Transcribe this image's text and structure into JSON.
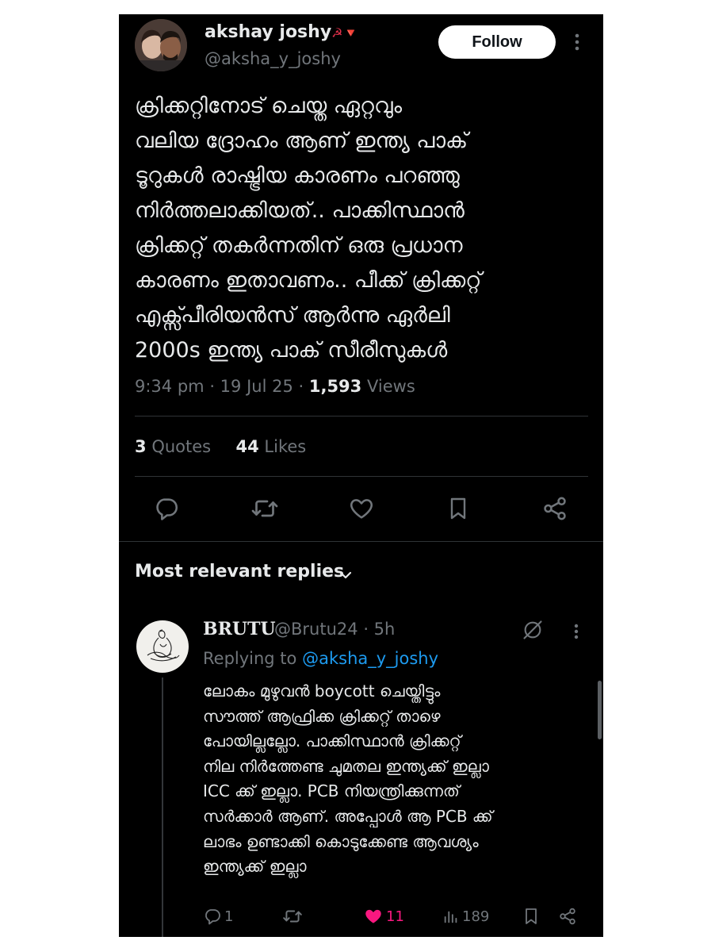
{
  "author": {
    "name": "akshay joshy",
    "name_emoji": "☭🔻",
    "handle": "@aksha_y_joshy",
    "follow_label": "Follow"
  },
  "tweet": {
    "lines": [
      "ക്രിക്കറ്റിനോട് ചെയ്ത ഏറ്റവും",
      "വലിയ ദ്രോഹം ആണ് ഇന്ത്യ പാക്",
      "ടൂറുകൾ രാഷ്ട്രിയ കാരണം പറഞ്ഞു",
      "നിർത്തലാക്കിയത്.. പാക്കിസ്ഥാൻ",
      "ക്രിക്കറ്റ് തകർന്നതിന് ഒരു പ്രധാന",
      "കാരണം ഇതാവണം.. പീക്ക് ക്രിക്കറ്റ്",
      "എക്സ്പീരിയൻസ് ആർന്നു ഏർലി",
      "2000s ഇന്ത്യ പാക് സീരീസുകൾ"
    ],
    "time": "9:34 pm",
    "date": "19 Jul 25",
    "views_count": "1,593",
    "views_label": "Views",
    "quotes_count": "3",
    "quotes_label": "Quotes",
    "likes_count": "44",
    "likes_label": "Likes"
  },
  "replies_header": "Most relevant replies",
  "reply": {
    "name": "BRUTU",
    "handle": "@Brutu24",
    "age": "5h",
    "replying_prefix": "Replying to",
    "replying_handle": "@aksha_y_joshy",
    "lines": [
      "ലോകം മുഴുവൻ boycott ചെയ്തിട്ടും",
      "സൗത്ത് ആഫ്രിക്ക ക്രിക്കറ്റ് താഴെ",
      "പോയില്ലല്ലോ. പാക്കിസ്ഥാൻ ക്രിക്കറ്റ്",
      "നില നിർത്തേണ്ട ചുമതല ഇന്ത്യക്ക് ഇല്ലാ",
      "ICC ക്ക് ഇല്ലാ. PCB നിയന്ത്രിക്കുന്നത്",
      "സർക്കാർ ആണ്. അപ്പോൾ ആ PCB ക്ക്",
      "ലാഭം ഉണ്ടാക്കി കൊടുക്കേണ്ട ആവശ്യം",
      "ഇന്ത്യക്ക് ഇല്ലാ"
    ],
    "reply_count": "1",
    "like_count": "11",
    "view_count": "189"
  },
  "colors": {
    "background": "#000000",
    "text": "#e7e9ea",
    "muted": "#71767b",
    "link": "#1d9bf0",
    "like_active": "#f91880"
  },
  "icons": [
    "more-vertical-icon",
    "reply-icon",
    "retweet-icon",
    "like-icon",
    "bookmark-icon",
    "share-icon",
    "chevron-down-icon",
    "grok-icon",
    "views-icon",
    "heart-filled-icon"
  ]
}
